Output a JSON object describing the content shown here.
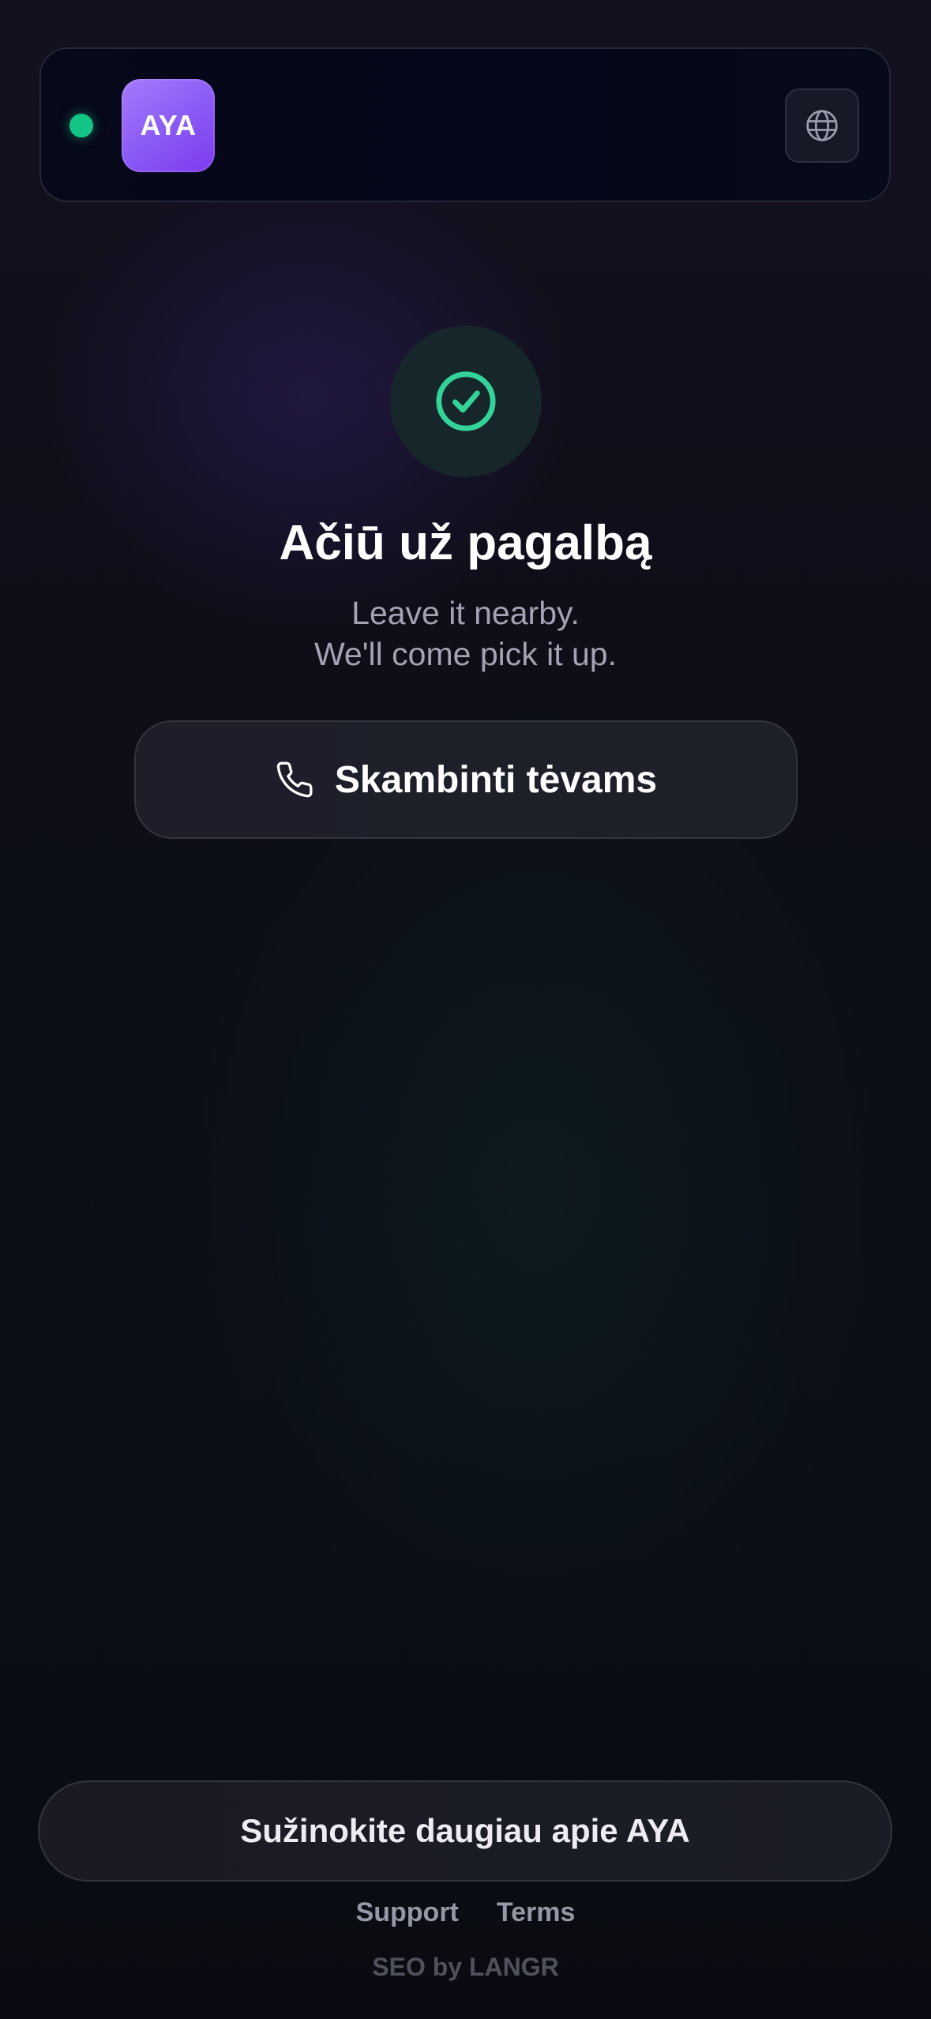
{
  "header": {
    "logo_text": "AYA",
    "status": "online",
    "status_color": "#13c486",
    "logo_color": "#8b5cf6",
    "language_icon": "globe-icon"
  },
  "main": {
    "success_icon": "check-circle-icon",
    "accent_color": "#34d399",
    "title": "Ačiū už pagalbą",
    "subtitle_line1": "Leave it nearby.",
    "subtitle_line2": "We'll come pick it up.",
    "call_button": {
      "icon": "phone-icon",
      "label": "Skambinti tėvams"
    }
  },
  "footer": {
    "learn_more_label": "Sužinokite daugiau apie AYA",
    "links": [
      "Support",
      "Terms"
    ],
    "credit": "SEO by LANGR"
  }
}
